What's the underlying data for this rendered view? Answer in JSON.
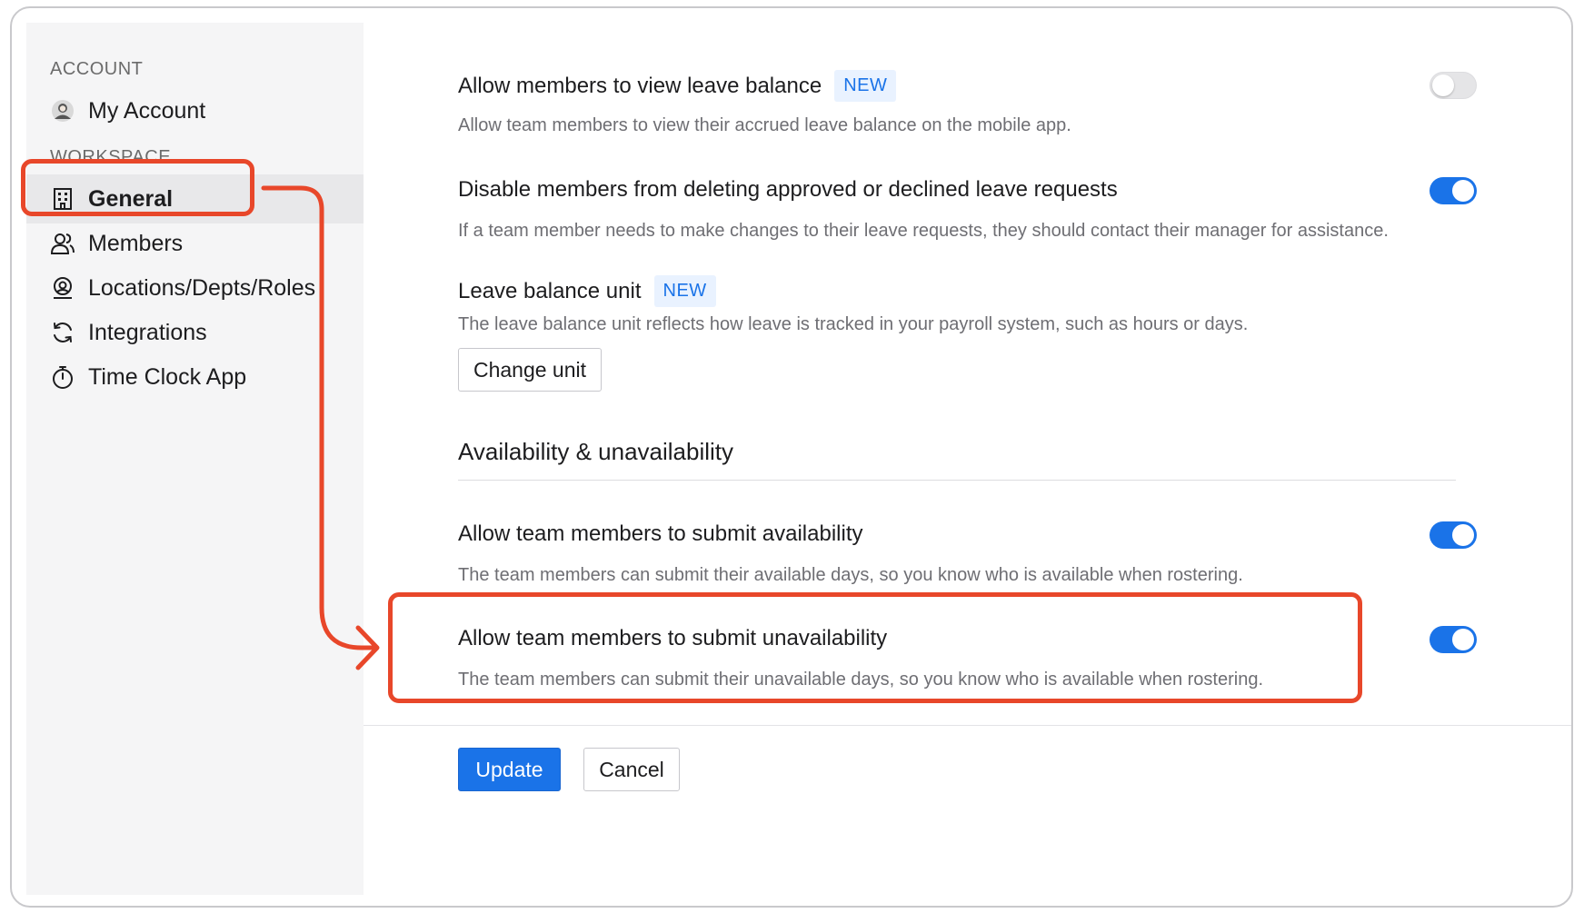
{
  "sidebar": {
    "account_label": "ACCOUNT",
    "my_account": "My Account",
    "workspace_label": "WORKSPACE",
    "items": [
      {
        "label": "General",
        "icon": "building-icon",
        "active": true
      },
      {
        "label": "Members",
        "icon": "members-icon",
        "active": false
      },
      {
        "label": "Locations/Depts/Roles",
        "icon": "location-icon",
        "active": false
      },
      {
        "label": "Integrations",
        "icon": "sync-icon",
        "active": false
      },
      {
        "label": "Time Clock App",
        "icon": "stopwatch-icon",
        "active": false
      }
    ]
  },
  "settings": {
    "view_leave_balance": {
      "title": "Allow members to view leave balance",
      "badge": "NEW",
      "desc": "Allow team members to view their accrued leave balance on the mobile app.",
      "enabled": false
    },
    "disable_deleting": {
      "title": "Disable members from deleting approved or declined leave requests",
      "desc": "If a team member needs to make changes to their leave requests, they should contact their manager for assistance.",
      "enabled": true
    },
    "leave_unit": {
      "title": "Leave balance unit",
      "badge": "NEW",
      "desc": "The leave balance unit reflects how leave is tracked in your payroll system, such as hours or days.",
      "button": "Change unit"
    },
    "section_heading": "Availability & unavailability",
    "submit_availability": {
      "title": "Allow team members to submit availability",
      "desc": "The team members can submit their available days, so you know who is available when rostering.",
      "enabled": true
    },
    "submit_unavailability": {
      "title": "Allow team members to submit unavailability",
      "desc": "The team members can submit their unavailable days, so you know who is available when rostering.",
      "enabled": true
    }
  },
  "footer": {
    "update": "Update",
    "cancel": "Cancel"
  },
  "colors": {
    "accent": "#1a73e8",
    "annotation": "#e8472a",
    "badge_bg": "#e9f2ff"
  }
}
